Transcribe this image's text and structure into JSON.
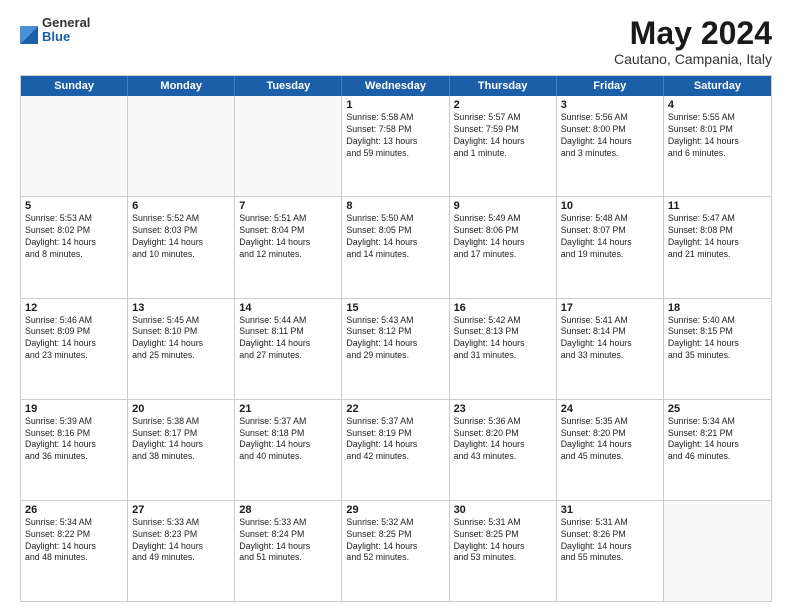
{
  "logo": {
    "general": "General",
    "blue": "Blue"
  },
  "title": {
    "month_year": "May 2024",
    "location": "Cautano, Campania, Italy"
  },
  "weekdays": [
    "Sunday",
    "Monday",
    "Tuesday",
    "Wednesday",
    "Thursday",
    "Friday",
    "Saturday"
  ],
  "rows": [
    [
      {
        "day": "",
        "text": ""
      },
      {
        "day": "",
        "text": ""
      },
      {
        "day": "",
        "text": ""
      },
      {
        "day": "1",
        "text": "Sunrise: 5:58 AM\nSunset: 7:58 PM\nDaylight: 13 hours\nand 59 minutes."
      },
      {
        "day": "2",
        "text": "Sunrise: 5:57 AM\nSunset: 7:59 PM\nDaylight: 14 hours\nand 1 minute."
      },
      {
        "day": "3",
        "text": "Sunrise: 5:56 AM\nSunset: 8:00 PM\nDaylight: 14 hours\nand 3 minutes."
      },
      {
        "day": "4",
        "text": "Sunrise: 5:55 AM\nSunset: 8:01 PM\nDaylight: 14 hours\nand 6 minutes."
      }
    ],
    [
      {
        "day": "5",
        "text": "Sunrise: 5:53 AM\nSunset: 8:02 PM\nDaylight: 14 hours\nand 8 minutes."
      },
      {
        "day": "6",
        "text": "Sunrise: 5:52 AM\nSunset: 8:03 PM\nDaylight: 14 hours\nand 10 minutes."
      },
      {
        "day": "7",
        "text": "Sunrise: 5:51 AM\nSunset: 8:04 PM\nDaylight: 14 hours\nand 12 minutes."
      },
      {
        "day": "8",
        "text": "Sunrise: 5:50 AM\nSunset: 8:05 PM\nDaylight: 14 hours\nand 14 minutes."
      },
      {
        "day": "9",
        "text": "Sunrise: 5:49 AM\nSunset: 8:06 PM\nDaylight: 14 hours\nand 17 minutes."
      },
      {
        "day": "10",
        "text": "Sunrise: 5:48 AM\nSunset: 8:07 PM\nDaylight: 14 hours\nand 19 minutes."
      },
      {
        "day": "11",
        "text": "Sunrise: 5:47 AM\nSunset: 8:08 PM\nDaylight: 14 hours\nand 21 minutes."
      }
    ],
    [
      {
        "day": "12",
        "text": "Sunrise: 5:46 AM\nSunset: 8:09 PM\nDaylight: 14 hours\nand 23 minutes."
      },
      {
        "day": "13",
        "text": "Sunrise: 5:45 AM\nSunset: 8:10 PM\nDaylight: 14 hours\nand 25 minutes."
      },
      {
        "day": "14",
        "text": "Sunrise: 5:44 AM\nSunset: 8:11 PM\nDaylight: 14 hours\nand 27 minutes."
      },
      {
        "day": "15",
        "text": "Sunrise: 5:43 AM\nSunset: 8:12 PM\nDaylight: 14 hours\nand 29 minutes."
      },
      {
        "day": "16",
        "text": "Sunrise: 5:42 AM\nSunset: 8:13 PM\nDaylight: 14 hours\nand 31 minutes."
      },
      {
        "day": "17",
        "text": "Sunrise: 5:41 AM\nSunset: 8:14 PM\nDaylight: 14 hours\nand 33 minutes."
      },
      {
        "day": "18",
        "text": "Sunrise: 5:40 AM\nSunset: 8:15 PM\nDaylight: 14 hours\nand 35 minutes."
      }
    ],
    [
      {
        "day": "19",
        "text": "Sunrise: 5:39 AM\nSunset: 8:16 PM\nDaylight: 14 hours\nand 36 minutes."
      },
      {
        "day": "20",
        "text": "Sunrise: 5:38 AM\nSunset: 8:17 PM\nDaylight: 14 hours\nand 38 minutes."
      },
      {
        "day": "21",
        "text": "Sunrise: 5:37 AM\nSunset: 8:18 PM\nDaylight: 14 hours\nand 40 minutes."
      },
      {
        "day": "22",
        "text": "Sunrise: 5:37 AM\nSunset: 8:19 PM\nDaylight: 14 hours\nand 42 minutes."
      },
      {
        "day": "23",
        "text": "Sunrise: 5:36 AM\nSunset: 8:20 PM\nDaylight: 14 hours\nand 43 minutes."
      },
      {
        "day": "24",
        "text": "Sunrise: 5:35 AM\nSunset: 8:20 PM\nDaylight: 14 hours\nand 45 minutes."
      },
      {
        "day": "25",
        "text": "Sunrise: 5:34 AM\nSunset: 8:21 PM\nDaylight: 14 hours\nand 46 minutes."
      }
    ],
    [
      {
        "day": "26",
        "text": "Sunrise: 5:34 AM\nSunset: 8:22 PM\nDaylight: 14 hours\nand 48 minutes."
      },
      {
        "day": "27",
        "text": "Sunrise: 5:33 AM\nSunset: 8:23 PM\nDaylight: 14 hours\nand 49 minutes."
      },
      {
        "day": "28",
        "text": "Sunrise: 5:33 AM\nSunset: 8:24 PM\nDaylight: 14 hours\nand 51 minutes."
      },
      {
        "day": "29",
        "text": "Sunrise: 5:32 AM\nSunset: 8:25 PM\nDaylight: 14 hours\nand 52 minutes."
      },
      {
        "day": "30",
        "text": "Sunrise: 5:31 AM\nSunset: 8:25 PM\nDaylight: 14 hours\nand 53 minutes."
      },
      {
        "day": "31",
        "text": "Sunrise: 5:31 AM\nSunset: 8:26 PM\nDaylight: 14 hours\nand 55 minutes."
      },
      {
        "day": "",
        "text": ""
      }
    ]
  ]
}
